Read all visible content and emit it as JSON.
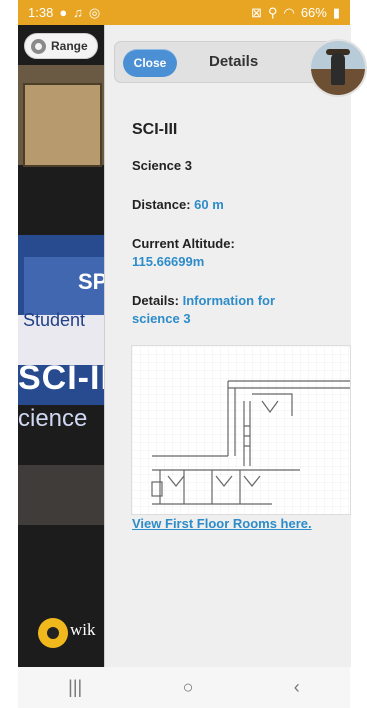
{
  "status_bar": {
    "time": "1:38",
    "battery": "66%"
  },
  "range_button": {
    "label": "Range"
  },
  "camera_overlay": {
    "label_sp": "SP",
    "label_student": "Student",
    "label_sci": "SCI-II",
    "label_science": "cience",
    "wiki_text": "wik"
  },
  "panel": {
    "close_label": "Close",
    "title": "Details",
    "place_name": "SCI-III",
    "subtitle": "Science 3",
    "distance_label": "Distance:",
    "distance_value": "60 m",
    "altitude_label": "Current Altitude:",
    "altitude_value": "115.66699m",
    "details_label": "Details:",
    "details_value_line1": "Information for",
    "details_value_line2": "science 3",
    "link_text": "View First Floor Rooms here."
  },
  "nav_bar": {
    "recent": "|||",
    "home": "○",
    "back": "‹"
  },
  "colors": {
    "status_bar": "#e8a524",
    "accent": "#2d8cc9",
    "close_button": "#4b8fd4"
  }
}
